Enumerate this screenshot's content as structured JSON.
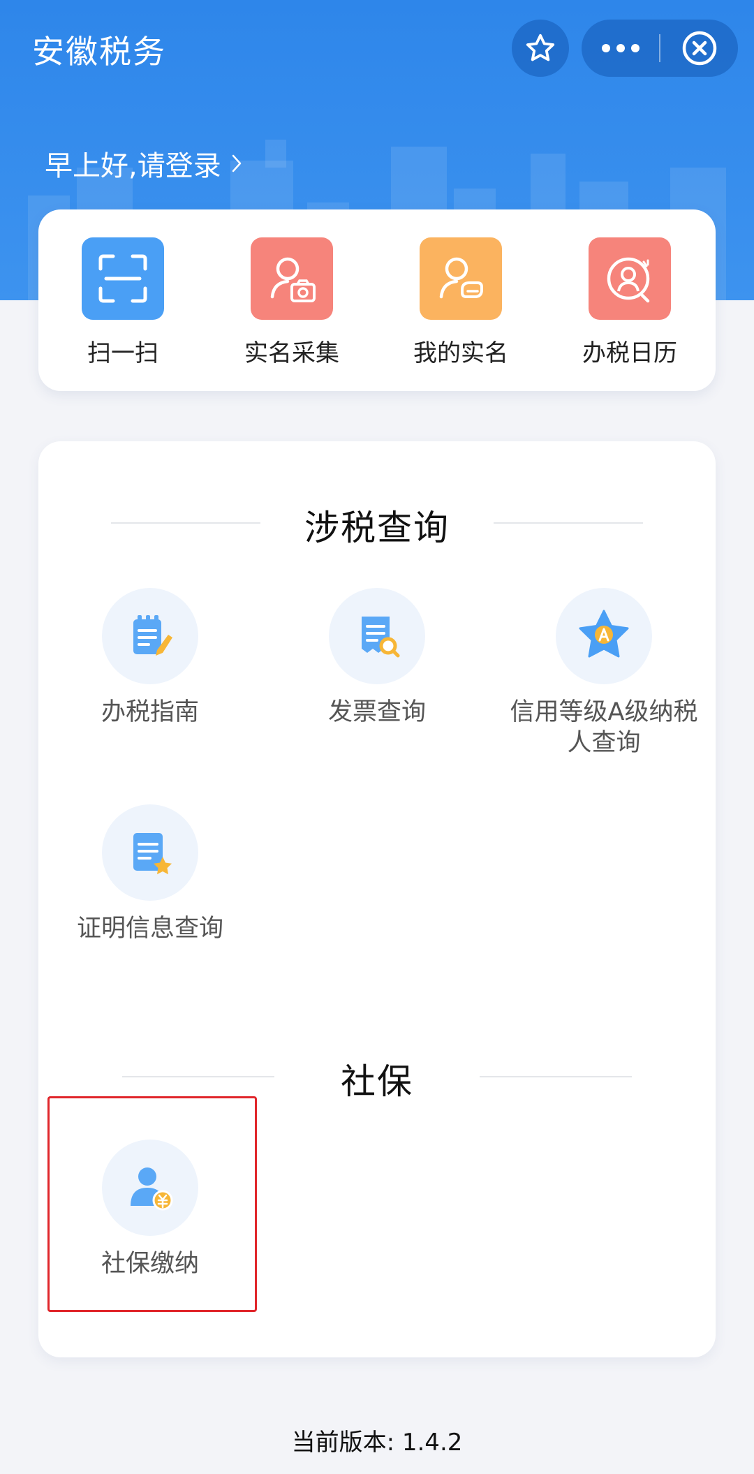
{
  "header": {
    "title": "安徽税务",
    "greeting": "早上好,请登录",
    "bg_color": "#2e86ea"
  },
  "quick_actions": [
    {
      "label": "扫一扫",
      "icon": "scan-icon",
      "color": "#4a9ff5"
    },
    {
      "label": "实名采集",
      "icon": "person-camera-icon",
      "color": "#f6847b"
    },
    {
      "label": "我的实名",
      "icon": "person-id-icon",
      "color": "#fbb35f"
    },
    {
      "label": "办税日历",
      "icon": "calendar-person-icon",
      "color": "#f6847b"
    }
  ],
  "sections": [
    {
      "title": "涉税查询",
      "items": [
        {
          "label": "办税指南",
          "icon": "guide-icon"
        },
        {
          "label": "发票查询",
          "icon": "invoice-search-icon"
        },
        {
          "label": "信用等级A级纳税人查询",
          "icon": "credit-star-icon"
        },
        {
          "label": "证明信息查询",
          "icon": "certificate-icon"
        }
      ]
    },
    {
      "title": "社保",
      "items": [
        {
          "label": "社保缴纳",
          "icon": "social-security-pay-icon"
        }
      ]
    }
  ],
  "footer": {
    "version": "当前版本: 1.4.2"
  },
  "colors": {
    "highlight": "#e0262b",
    "accent": "#4a9ff5"
  }
}
